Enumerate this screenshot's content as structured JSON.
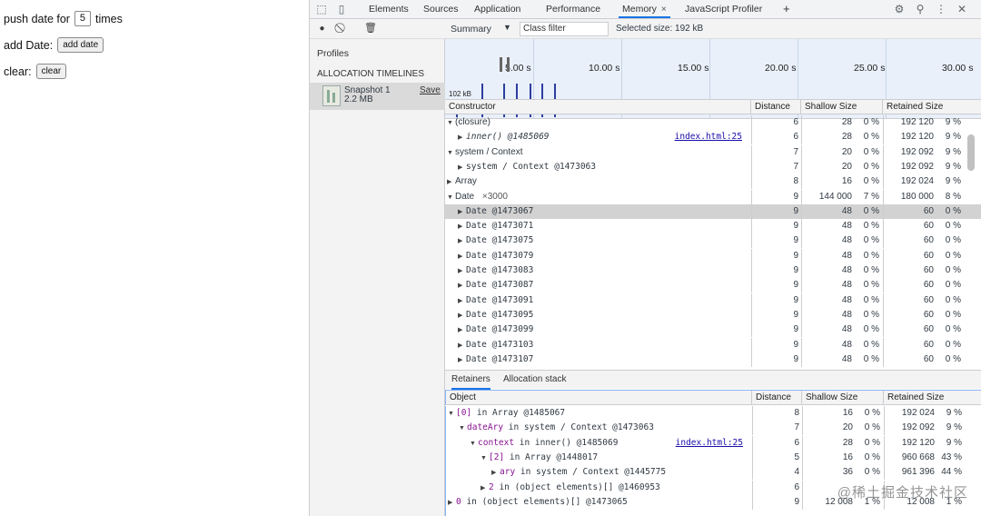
{
  "page": {
    "push_label_1": "push date for",
    "push_value": "5",
    "push_label_2": "times",
    "add_label": "add Date:",
    "add_button": "add date",
    "clear_label": "clear:",
    "clear_button": "clear"
  },
  "devtools": {
    "tabs": [
      {
        "label": "Elements"
      },
      {
        "label": "Sources"
      },
      {
        "label": "Application"
      },
      {
        "label": "Performance"
      },
      {
        "label": "Memory",
        "active": true
      },
      {
        "label": "JavaScript Profiler"
      }
    ],
    "add_tab": "+",
    "close_tab": "×"
  },
  "profiles": {
    "title": "Profiles",
    "section": "ALLOCATION TIMELINES",
    "snapshot_name": "Snapshot 1",
    "snapshot_size": "2.2 MB",
    "save_label": "Save"
  },
  "toolbar": {
    "view": "Summary",
    "class_filter_placeholder": "Class filter",
    "selected_size": "Selected size: 192 kB"
  },
  "timeline": {
    "labels": [
      "5.00 s",
      "10.00 s",
      "15.00 s",
      "20.00 s",
      "25.00 s",
      "30.00 s"
    ],
    "y_label": "102 kB",
    "bars": [
      0.3,
      0.85,
      0.85,
      0.85,
      0.85,
      0.85,
      0.85
    ]
  },
  "summary": {
    "headers": [
      "Constructor",
      "Distance",
      "Shallow Size",
      "Retained Size"
    ],
    "rows": [
      {
        "ind": 0,
        "tri": "▼",
        "name": "(closure)",
        "mono": false,
        "dist": "6",
        "shal": "28",
        "shalp": "0 %",
        "ret": "192 120",
        "retp": "9 %"
      },
      {
        "ind": 1,
        "tri": "▶",
        "name": "inner() @1485069",
        "mono": true,
        "italic": true,
        "link": "index.html:25",
        "dist": "6",
        "shal": "28",
        "shalp": "0 %",
        "ret": "192 120",
        "retp": "9 %"
      },
      {
        "ind": 0,
        "tri": "▼",
        "name": "system / Context",
        "mono": false,
        "dist": "7",
        "shal": "20",
        "shalp": "0 %",
        "ret": "192 092",
        "retp": "9 %"
      },
      {
        "ind": 1,
        "tri": "▶",
        "name": "system / Context @1473063",
        "mono": true,
        "dist": "7",
        "shal": "20",
        "shalp": "0 %",
        "ret": "192 092",
        "retp": "9 %"
      },
      {
        "ind": 0,
        "tri": "▶",
        "name": "Array",
        "mono": false,
        "dist": "8",
        "shal": "16",
        "shalp": "0 %",
        "ret": "192 024",
        "retp": "9 %"
      },
      {
        "ind": 0,
        "tri": "▼",
        "name": "Date",
        "count": "×3000",
        "mono": false,
        "dist": "9",
        "shal": "144 000",
        "shalp": "7 %",
        "ret": "180 000",
        "retp": "8 %"
      },
      {
        "ind": 1,
        "tri": "▶",
        "name": "Date @1473067",
        "mono": true,
        "sel": true,
        "dist": "9",
        "shal": "48",
        "shalp": "0 %",
        "ret": "60",
        "retp": "0 %"
      },
      {
        "ind": 1,
        "tri": "▶",
        "name": "Date @1473071",
        "mono": true,
        "dist": "9",
        "shal": "48",
        "shalp": "0 %",
        "ret": "60",
        "retp": "0 %"
      },
      {
        "ind": 1,
        "tri": "▶",
        "name": "Date @1473075",
        "mono": true,
        "dist": "9",
        "shal": "48",
        "shalp": "0 %",
        "ret": "60",
        "retp": "0 %"
      },
      {
        "ind": 1,
        "tri": "▶",
        "name": "Date @1473079",
        "mono": true,
        "dist": "9",
        "shal": "48",
        "shalp": "0 %",
        "ret": "60",
        "retp": "0 %"
      },
      {
        "ind": 1,
        "tri": "▶",
        "name": "Date @1473083",
        "mono": true,
        "dist": "9",
        "shal": "48",
        "shalp": "0 %",
        "ret": "60",
        "retp": "0 %"
      },
      {
        "ind": 1,
        "tri": "▶",
        "name": "Date @1473087",
        "mono": true,
        "dist": "9",
        "shal": "48",
        "shalp": "0 %",
        "ret": "60",
        "retp": "0 %"
      },
      {
        "ind": 1,
        "tri": "▶",
        "name": "Date @1473091",
        "mono": true,
        "dist": "9",
        "shal": "48",
        "shalp": "0 %",
        "ret": "60",
        "retp": "0 %"
      },
      {
        "ind": 1,
        "tri": "▶",
        "name": "Date @1473095",
        "mono": true,
        "dist": "9",
        "shal": "48",
        "shalp": "0 %",
        "ret": "60",
        "retp": "0 %"
      },
      {
        "ind": 1,
        "tri": "▶",
        "name": "Date @1473099",
        "mono": true,
        "dist": "9",
        "shal": "48",
        "shalp": "0 %",
        "ret": "60",
        "retp": "0 %"
      },
      {
        "ind": 1,
        "tri": "▶",
        "name": "Date @1473103",
        "mono": true,
        "dist": "9",
        "shal": "48",
        "shalp": "0 %",
        "ret": "60",
        "retp": "0 %"
      },
      {
        "ind": 1,
        "tri": "▶",
        "name": "Date @1473107",
        "mono": true,
        "dist": "9",
        "shal": "48",
        "shalp": "0 %",
        "ret": "60",
        "retp": "0 %"
      }
    ]
  },
  "retainers": {
    "tabs": [
      "Retainers",
      "Allocation stack"
    ],
    "headers": [
      "Object",
      "Distance",
      "Shallow Size",
      "Retained Size"
    ],
    "rows": [
      {
        "ind": 0,
        "tri": "▼",
        "pre": "[0]",
        "name": " in Array @1485067",
        "dist": "8",
        "shal": "16",
        "shalp": "0 %",
        "ret": "192 024",
        "retp": "9 %"
      },
      {
        "ind": 1,
        "tri": "▼",
        "pre": "dateAry",
        "name": " in system / Context @1473063",
        "dist": "7",
        "shal": "20",
        "shalp": "0 %",
        "ret": "192 092",
        "retp": "9 %"
      },
      {
        "ind": 2,
        "tri": "▼",
        "pre": "context",
        "name": " in inner() @1485069",
        "link": "index.html:25",
        "dist": "6",
        "shal": "28",
        "shalp": "0 %",
        "ret": "192 120",
        "retp": "9 %"
      },
      {
        "ind": 3,
        "tri": "▼",
        "pre": "[2]",
        "name": " in Array @1448017",
        "dist": "5",
        "shal": "16",
        "shalp": "0 %",
        "ret": "960 668",
        "retp": "43 %"
      },
      {
        "ind": 4,
        "tri": "▶",
        "pre": "ary",
        "name": " in system / Context @1445775",
        "dist": "4",
        "shal": "36",
        "shalp": "0 %",
        "ret": "961 396",
        "retp": "44 %"
      },
      {
        "ind": 3,
        "tri": "▶",
        "pre": "2",
        "name": " in (object elements)[] @1460953",
        "dist": "6",
        "shal": "",
        "shalp": "",
        "ret": "",
        "retp": ""
      },
      {
        "ind": 0,
        "tri": "▶",
        "pre": "0",
        "name": " in (object elements)[] @1473065",
        "dist": "9",
        "shal": "12 008",
        "shalp": "1 %",
        "ret": "12 008",
        "retp": "1 %"
      }
    ]
  },
  "watermark": "@稀土掘金技术社区"
}
